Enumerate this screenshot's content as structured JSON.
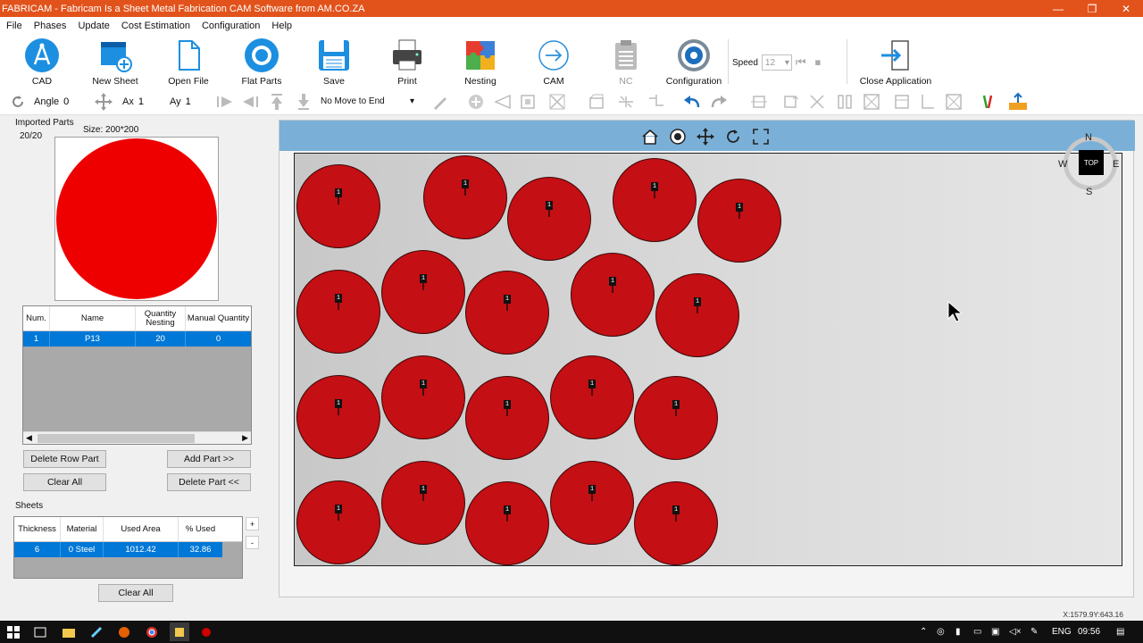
{
  "window": {
    "title": "FABRICAM - Fabricam Is a Sheet Metal Fabrication CAM Software from AM.CO.ZA",
    "minimize": "—",
    "maximize": "❐",
    "close": "✕"
  },
  "menu": [
    "File",
    "Phases",
    "Update",
    "Cost Estimation",
    "Configuration",
    "Help"
  ],
  "toolbar": {
    "cad": "CAD",
    "new_sheet": "New Sheet",
    "open_file": "Open File",
    "flat_parts": "Flat Parts",
    "save": "Save",
    "print": "Print",
    "nesting": "Nesting",
    "cam": "CAM",
    "nc": "NC",
    "configuration": "Configuration",
    "speed_label": "Speed",
    "speed_value": "12",
    "close_application": "Close Application"
  },
  "toolbar2": {
    "angle_label": "Angle",
    "angle_value": "0",
    "ax_label": "Ax",
    "ax_value": "1",
    "ay_label": "Ay",
    "ay_value": "1",
    "move_mode": "No Move to End"
  },
  "left": {
    "imported_parts": "Imported Parts",
    "count": "20/20",
    "size": "Size: 200*200",
    "parts_table": {
      "headers": [
        "Num.",
        "Name",
        "Quantity Nesting",
        "Manual Quantity"
      ],
      "rows": [
        [
          "1",
          "P13",
          "20",
          "0"
        ]
      ]
    },
    "delete_row_part": "Delete Row Part",
    "add_part": "Add Part >>",
    "clear_all_parts": "Clear All",
    "delete_part": "Delete Part <<",
    "sheets_label": "Sheets",
    "sheets_table": {
      "headers": [
        "Thickness",
        "Material",
        "Used Area",
        "% Used"
      ],
      "rows": [
        [
          "6",
          "0  Steel",
          "1012.42",
          "32.86"
        ]
      ]
    },
    "plus": "+",
    "minus": "-",
    "clear_all_sheets": "Clear All"
  },
  "canvas": {
    "part_label": "1",
    "part_count": 20,
    "compass": {
      "n": "N",
      "s": "S",
      "e": "E",
      "w": "W",
      "view": "TOP"
    }
  },
  "status": {
    "coords": "X:1579.9Y:643.16"
  },
  "taskbar": {
    "lang": "ENG",
    "time": "09:56"
  }
}
